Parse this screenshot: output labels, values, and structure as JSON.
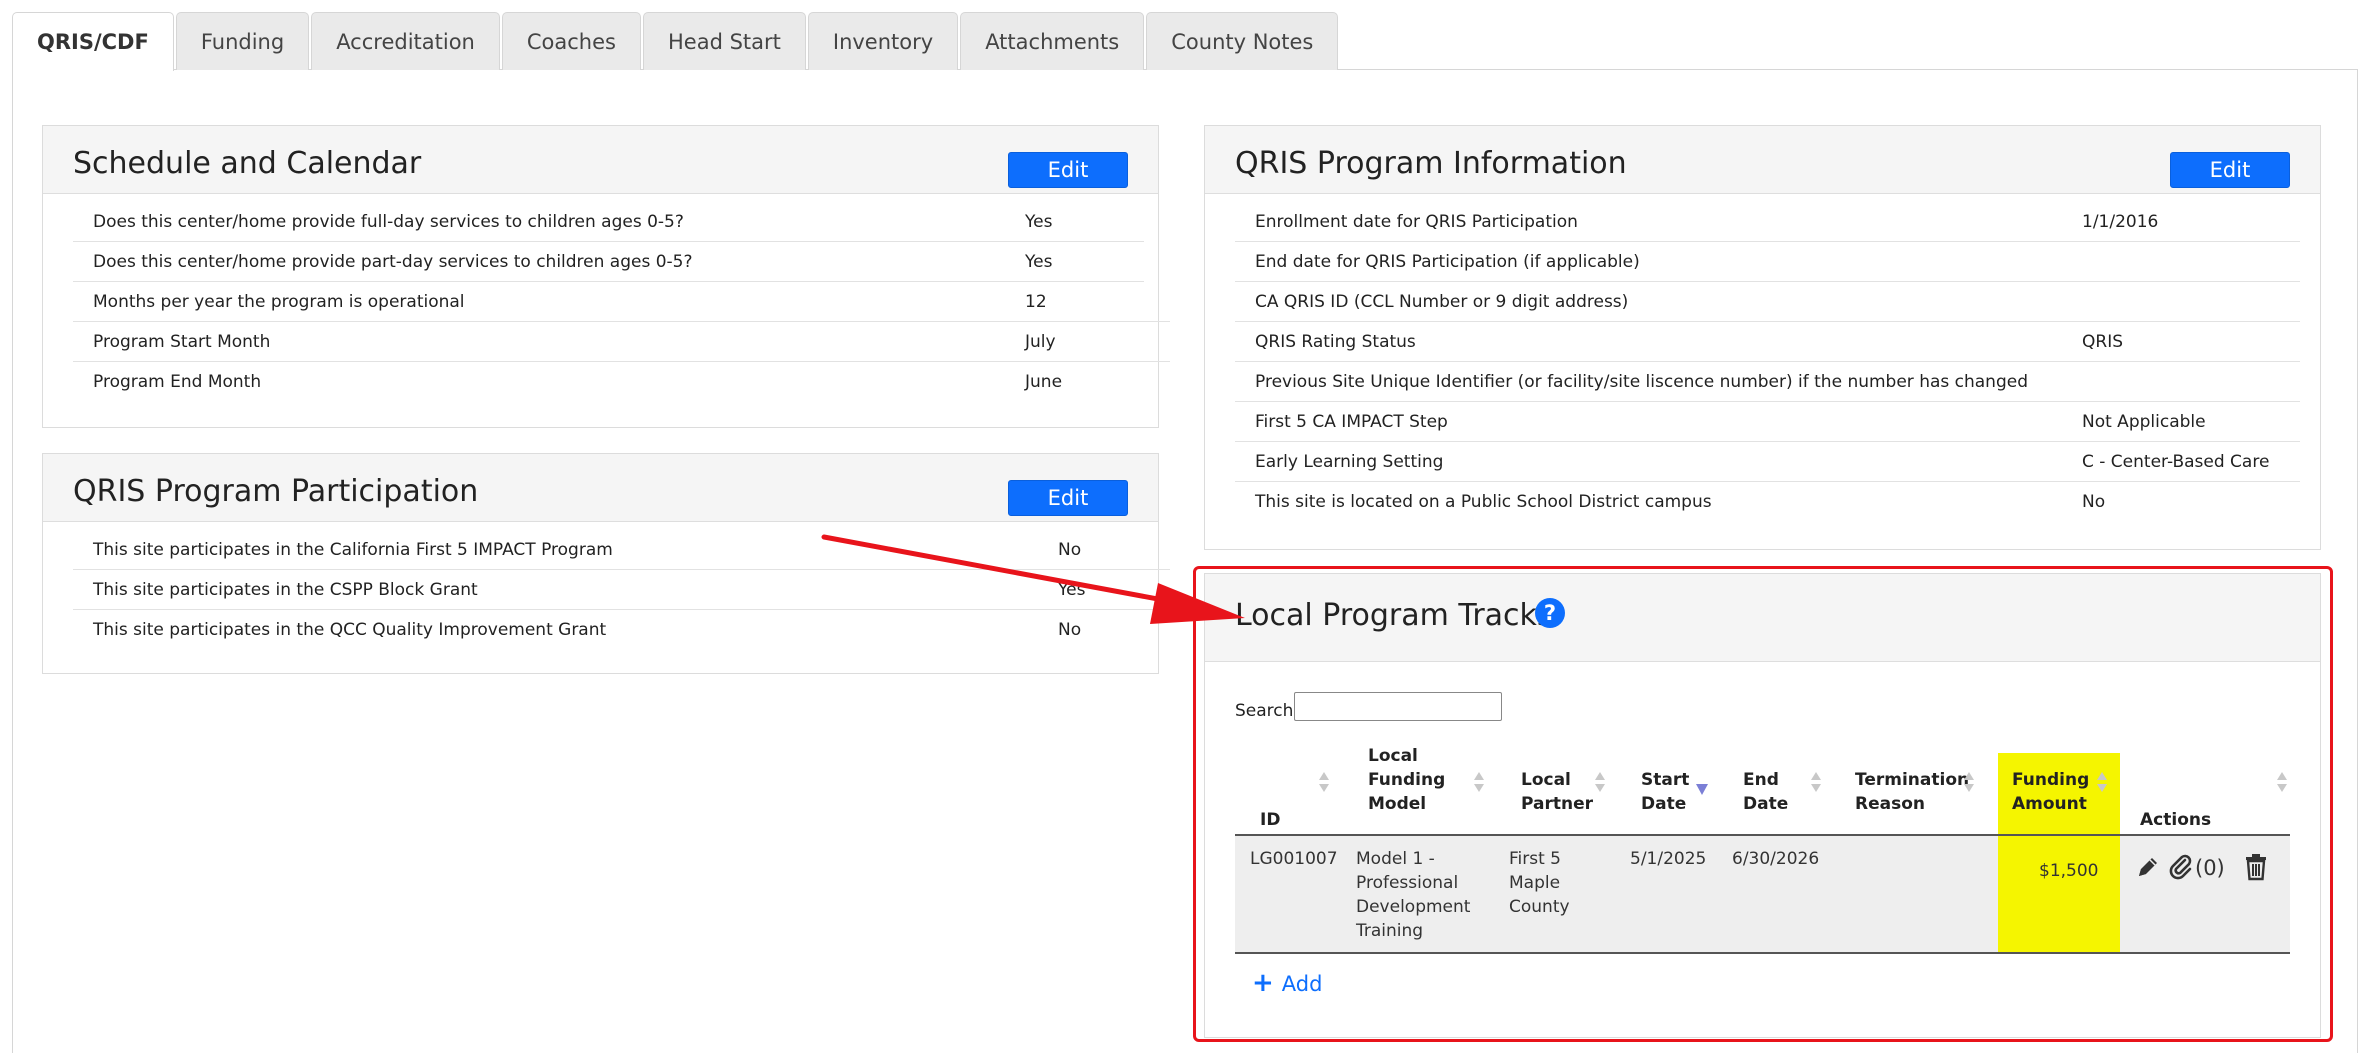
{
  "tabs": [
    {
      "label": "QRIS/CDF",
      "active": true
    },
    {
      "label": "Funding"
    },
    {
      "label": "Accreditation"
    },
    {
      "label": "Coaches"
    },
    {
      "label": "Head Start"
    },
    {
      "label": "Inventory"
    },
    {
      "label": "Attachments"
    },
    {
      "label": "County Notes"
    }
  ],
  "schedule": {
    "title": "Schedule and Calendar",
    "edit_label": "Edit",
    "rows": [
      {
        "label": "Does this center/home provide full-day services to children ages 0-5?",
        "value": "Yes"
      },
      {
        "label": "Does this center/home provide part-day services to children ages 0-5?",
        "value": "Yes"
      },
      {
        "label": "Months per year the program is operational",
        "value": "12"
      },
      {
        "label": "Program Start Month",
        "value": "July"
      },
      {
        "label": "Program End Month",
        "value": "June"
      }
    ]
  },
  "participation": {
    "title": "QRIS Program Participation",
    "edit_label": "Edit",
    "rows": [
      {
        "label": "This site participates in the California First 5 IMPACT Program",
        "value": "No"
      },
      {
        "label": "This site participates in the CSPP Block Grant",
        "value": "Yes"
      },
      {
        "label": "This site participates in the QCC Quality Improvement Grant",
        "value": "No"
      }
    ]
  },
  "qris_info": {
    "title": "QRIS Program Information",
    "edit_label": "Edit",
    "rows": [
      {
        "label": "Enrollment date for QRIS Participation",
        "value": "1/1/2016"
      },
      {
        "label": "End date for QRIS Participation (if applicable)",
        "value": ""
      },
      {
        "label": "CA QRIS ID (CCL Number or 9 digit address)",
        "value": ""
      },
      {
        "label": "QRIS Rating Status",
        "value": "QRIS"
      },
      {
        "label": "Previous Site Unique Identifier (or facility/site liscence number) if the number has changed",
        "value": ""
      },
      {
        "label": "First 5 CA IMPACT Step",
        "value": "Not Applicable"
      },
      {
        "label": "Early Learning Setting",
        "value": "C - Center-Based Care"
      },
      {
        "label": "This site is located on a Public School District campus",
        "value": "No"
      }
    ]
  },
  "tracks": {
    "title": "Local Program Tracks",
    "help_icon": "question-circle-icon",
    "search_label": "Search:",
    "search_value": "",
    "columns": {
      "id": "ID",
      "model_1": "Local",
      "model_2": "Funding",
      "model_3": "Model",
      "partner_1": "Local",
      "partner_2": "Partner",
      "start_1": "Start",
      "start_2": "Date",
      "end_1": "End",
      "end_2": "Date",
      "term_1": "Termination",
      "term_2": "Reason",
      "amount_1": "Funding",
      "amount_2": "Amount",
      "actions": "Actions"
    },
    "row": {
      "id": "LG001007",
      "model_lines": [
        "Model 1 -",
        "Professional",
        "Development",
        "Training"
      ],
      "partner_lines": [
        "First 5",
        "Maple",
        "County"
      ],
      "start": "5/1/2025",
      "end": "6/30/2026",
      "termination": "",
      "amount": "$1,500",
      "attachments": "(0)"
    },
    "add_label": "Add"
  },
  "colors": {
    "primary": "#0d6efd",
    "highlight": "#f5f500",
    "annotation_red": "#e8141b"
  }
}
